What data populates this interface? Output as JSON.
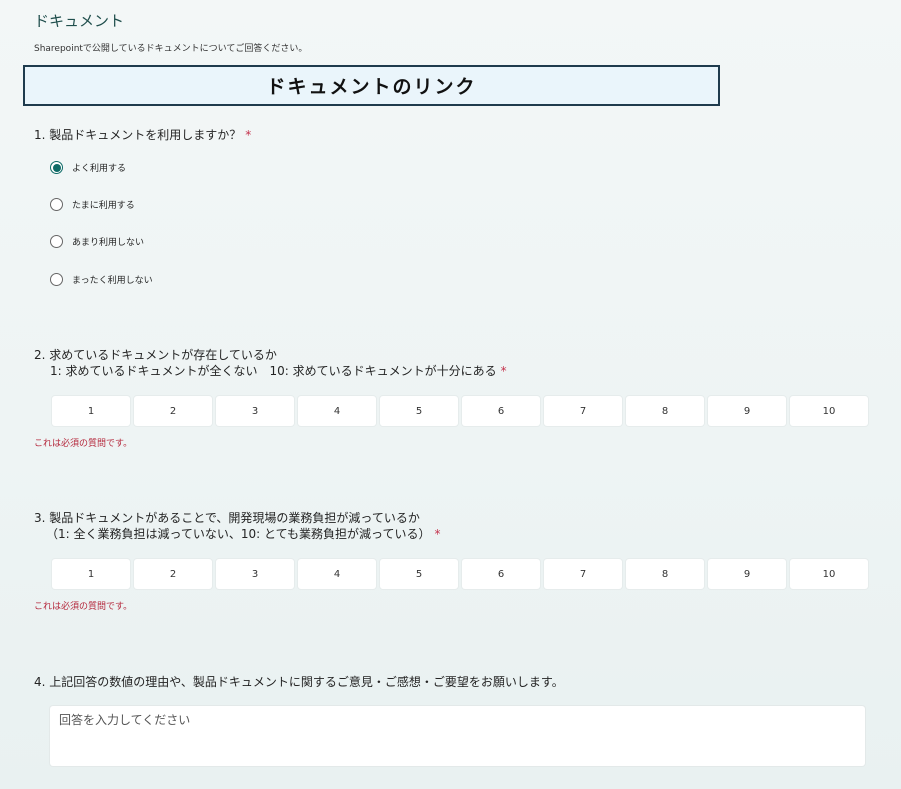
{
  "form": {
    "title": "ドキュメント",
    "description": "Sharepointで公開しているドキュメントについてご回答ください。",
    "link_text": "ドキュメントのリンク",
    "required_mark": "*",
    "error_text": "これは必須の質問です。"
  },
  "q1": {
    "title": "1. 製品ドキュメントを利用しますか？",
    "options": [
      {
        "label": "よく利用する",
        "selected": true
      },
      {
        "label": "たまに利用する",
        "selected": false
      },
      {
        "label": "あまり利用しない",
        "selected": false
      },
      {
        "label": "まったく利用しない",
        "selected": false
      }
    ]
  },
  "q2": {
    "title_line1": "2. 求めているドキュメントが存在しているか",
    "title_line2": "1: 求めているドキュメントが全くない　10: 求めているドキュメントが十分にある",
    "scale": [
      "1",
      "2",
      "3",
      "4",
      "5",
      "6",
      "7",
      "8",
      "9",
      "10"
    ]
  },
  "q3": {
    "title_line1": "3. 製品ドキュメントがあることで、開発現場の業務負担が減っているか",
    "title_line2": "（1: 全く業務負担は減っていない、10: とても業務負担が減っている）",
    "scale": [
      "1",
      "2",
      "3",
      "4",
      "5",
      "6",
      "7",
      "8",
      "9",
      "10"
    ]
  },
  "q4": {
    "title": "4. 上記回答の数値の理由や、製品ドキュメントに関するご意見・ご感想・ご要望をお願いします。",
    "placeholder": "回答を入力してください"
  },
  "colors": {
    "accent": "#0f6b67",
    "error": "#b5283c",
    "link_border": "#1f3b4d",
    "link_bg": "#eaf5fb"
  }
}
